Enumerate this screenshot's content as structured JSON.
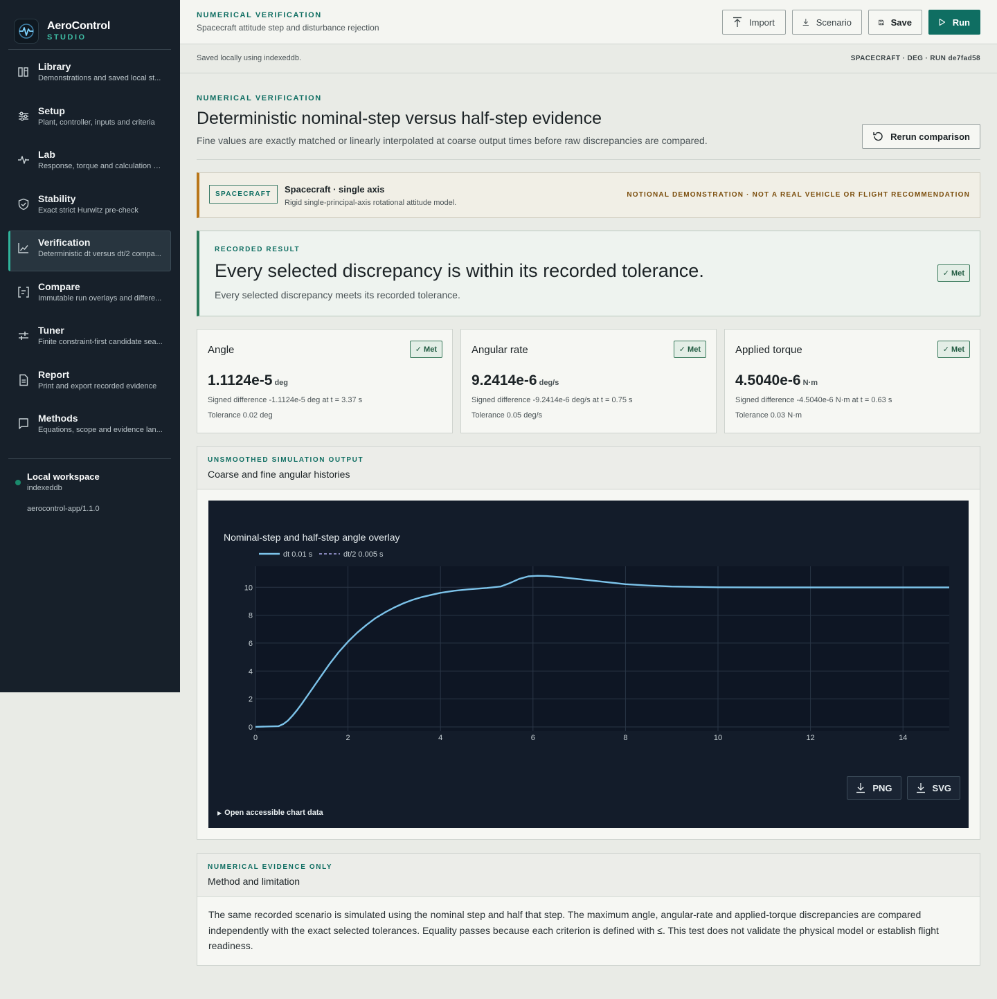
{
  "app": {
    "name": "AeroControl",
    "subtitle": "STUDIO"
  },
  "sidebar": {
    "items": [
      {
        "title": "Library",
        "desc": "Demonstrations and saved local st...",
        "icon": "library-icon"
      },
      {
        "title": "Setup",
        "desc": "Plant, controller, inputs and criteria",
        "icon": "sliders-icon"
      },
      {
        "title": "Lab",
        "desc": "Response, torque and calculation e...",
        "icon": "pulse-icon"
      },
      {
        "title": "Stability",
        "desc": "Exact strict Hurwitz pre-check",
        "icon": "shield-check-icon"
      },
      {
        "title": "Verification",
        "desc": "Deterministic dt versus dt/2 compa...",
        "icon": "chart-line-icon",
        "active": true
      },
      {
        "title": "Compare",
        "desc": "Immutable run overlays and differe...",
        "icon": "compare-icon"
      },
      {
        "title": "Tuner",
        "desc": "Finite constraint-first candidate sea...",
        "icon": "tuner-icon"
      },
      {
        "title": "Report",
        "desc": "Print and export recorded evidence",
        "icon": "document-icon"
      },
      {
        "title": "Methods",
        "desc": "Equations, scope and evidence lan...",
        "icon": "book-icon"
      }
    ],
    "workspace": {
      "title": "Local workspace",
      "storage": "indexeddb",
      "version": "aerocontrol-app/1.1.0"
    }
  },
  "header": {
    "eyebrow": "NUMERICAL VERIFICATION",
    "subtitle": "Spacecraft attitude step and disturbance rejection",
    "buttons": {
      "import": "Import",
      "scenario": "Scenario",
      "save": "Save",
      "run": "Run"
    }
  },
  "subbar": {
    "left": "Saved locally using indexeddb.",
    "right": "SPACECRAFT · DEG · RUN de7fad58"
  },
  "page": {
    "eyebrow": "NUMERICAL VERIFICATION",
    "title": "Deterministic nominal-step versus half-step evidence",
    "description": "Fine values are exactly matched or linearly interpolated at coarse output times before raw discrepancies are compared.",
    "rerun_label": "Rerun comparison"
  },
  "banner": {
    "tag": "SPACECRAFT",
    "title": "Spacecraft · single axis",
    "subtitle": "Rigid single-principal-axis rotational attitude model.",
    "warning": "NOTIONAL DEMONSTRATION · NOT A REAL VEHICLE OR FLIGHT RECOMMENDATION"
  },
  "result": {
    "eyebrow": "RECORDED RESULT",
    "title": "Every selected discrepancy is within its recorded tolerance.",
    "subtitle": "Every selected discrepancy meets its recorded tolerance.",
    "badge": "✓ Met"
  },
  "metrics": [
    {
      "label": "Angle",
      "value": "1.1124e-5",
      "unit": "deg",
      "diff": "Signed difference -1.1124e-5 deg at t = 3.37 s",
      "tolerance": "Tolerance 0.02 deg",
      "badge": "✓ Met"
    },
    {
      "label": "Angular rate",
      "value": "9.2414e-6",
      "unit": "deg/s",
      "diff": "Signed difference -9.2414e-6 deg/s at t = 0.75 s",
      "tolerance": "Tolerance 0.05 deg/s",
      "badge": "✓ Met"
    },
    {
      "label": "Applied torque",
      "value": "4.5040e-6",
      "unit": "N·m",
      "diff": "Signed difference -4.5040e-6 N·m at t = 0.63 s",
      "tolerance": "Tolerance 0.03 N·m",
      "badge": "✓ Met"
    }
  ],
  "chart_panel": {
    "eyebrow": "UNSMOOTHED SIMULATION OUTPUT",
    "title": "Coarse and fine angular histories",
    "png_label": "PNG",
    "svg_label": "SVG",
    "data_toggle": "Open accessible chart data"
  },
  "chart_data": {
    "type": "line",
    "title": "Nominal-step and half-step angle overlay",
    "xlabel": "",
    "ylabel": "",
    "xlim": [
      0,
      15
    ],
    "ylim": [
      -0.3,
      11.5
    ],
    "xticks": [
      0,
      2,
      4,
      6,
      8,
      10,
      12,
      14
    ],
    "yticks": [
      0,
      2,
      4,
      6,
      8,
      10
    ],
    "grid": true,
    "legend": "top-left",
    "series": [
      {
        "name": "dt 0.01 s",
        "style": "solid",
        "color": "#7cc3ea",
        "x": [
          0,
          0.5,
          0.6,
          0.7,
          0.8,
          0.9,
          1.0,
          1.2,
          1.4,
          1.6,
          1.8,
          2.0,
          2.2,
          2.4,
          2.6,
          2.8,
          3.0,
          3.2,
          3.4,
          3.6,
          3.8,
          4.0,
          4.3,
          4.6,
          5.0,
          5.3,
          5.5,
          5.7,
          5.9,
          6.1,
          6.3,
          6.6,
          7.0,
          7.5,
          8.0,
          8.5,
          9.0,
          10.0,
          11.0,
          12.0,
          13.0,
          14.0,
          15.0
        ],
        "y": [
          0,
          0.05,
          0.2,
          0.45,
          0.8,
          1.2,
          1.65,
          2.6,
          3.55,
          4.5,
          5.35,
          6.1,
          6.75,
          7.3,
          7.8,
          8.2,
          8.55,
          8.85,
          9.1,
          9.3,
          9.45,
          9.6,
          9.75,
          9.85,
          9.95,
          10.05,
          10.3,
          10.6,
          10.78,
          10.82,
          10.8,
          10.72,
          10.58,
          10.4,
          10.22,
          10.12,
          10.05,
          10.0,
          9.99,
          9.99,
          9.99,
          9.99,
          9.99
        ]
      },
      {
        "name": "dt/2 0.005 s",
        "style": "dashed",
        "color": "#a9a7e8",
        "x": [
          0,
          0.5,
          0.6,
          0.7,
          0.8,
          0.9,
          1.0,
          1.2,
          1.4,
          1.6,
          1.8,
          2.0,
          2.2,
          2.4,
          2.6,
          2.8,
          3.0,
          3.2,
          3.4,
          3.6,
          3.8,
          4.0,
          4.3,
          4.6,
          5.0,
          5.3,
          5.5,
          5.7,
          5.9,
          6.1,
          6.3,
          6.6,
          7.0,
          7.5,
          8.0,
          8.5,
          9.0,
          10.0,
          11.0,
          12.0,
          13.0,
          14.0,
          15.0
        ],
        "y": [
          0,
          0.05,
          0.2,
          0.45,
          0.8,
          1.2,
          1.65,
          2.6,
          3.55,
          4.5,
          5.35,
          6.1,
          6.75,
          7.3,
          7.8,
          8.2,
          8.55,
          8.85,
          9.1,
          9.3,
          9.45,
          9.6,
          9.75,
          9.85,
          9.95,
          10.05,
          10.3,
          10.6,
          10.78,
          10.82,
          10.8,
          10.72,
          10.58,
          10.4,
          10.22,
          10.12,
          10.05,
          10.0,
          9.99,
          9.99,
          9.99,
          9.99,
          9.99
        ]
      }
    ]
  },
  "method_panel": {
    "eyebrow": "NUMERICAL EVIDENCE ONLY",
    "title": "Method and limitation",
    "text": "The same recorded scenario is simulated using the nominal step and half that step. The maximum angle, angular-rate and applied-torque discrepancies are compared independently with the exact selected tolerances. Equality passes because each criterion is defined with ≤. This test does not validate the physical model or establish flight readiness."
  },
  "colors": {
    "accent": "#0f6e62",
    "sidebar": "#17202a",
    "warning": "#b9761a",
    "success": "#2a7a5a",
    "chart_bg": "#131c2a"
  }
}
